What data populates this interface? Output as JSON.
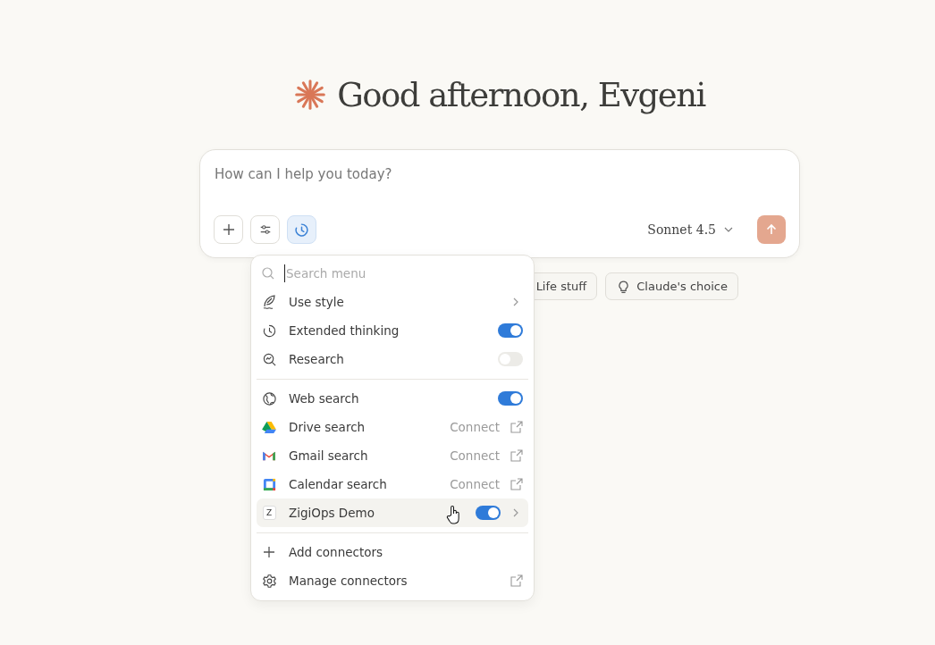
{
  "greeting": {
    "title": "Good afternoon, Evgeni"
  },
  "composer": {
    "placeholder": "How can I help you today?",
    "model": "Sonnet 4.5",
    "tools_active": true
  },
  "chips": [
    {
      "label": "Life stuff"
    },
    {
      "label": "Claude's choice"
    }
  ],
  "menu": {
    "search_placeholder": "Search menu",
    "groups": [
      [
        {
          "kind": "submenu",
          "label": "Use style",
          "highlighted": false
        },
        {
          "kind": "toggle",
          "label": "Extended thinking",
          "on": true,
          "highlighted": false
        },
        {
          "kind": "toggle",
          "label": "Research",
          "on": false,
          "highlighted": false
        }
      ],
      [
        {
          "kind": "toggle",
          "label": "Web search",
          "on": true,
          "highlighted": false
        },
        {
          "kind": "connect",
          "label": "Drive search",
          "action": "Connect",
          "highlighted": false
        },
        {
          "kind": "connect",
          "label": "Gmail search",
          "action": "Connect",
          "highlighted": false
        },
        {
          "kind": "connect",
          "label": "Calendar search",
          "action": "Connect",
          "highlighted": false
        },
        {
          "kind": "toggle-submenu",
          "badge": "Z",
          "label": "ZigiOps Demo",
          "on": true,
          "highlighted": true
        }
      ],
      [
        {
          "kind": "action",
          "label": "Add connectors",
          "highlighted": false
        },
        {
          "kind": "external",
          "label": "Manage connectors",
          "highlighted": false
        }
      ]
    ]
  }
}
